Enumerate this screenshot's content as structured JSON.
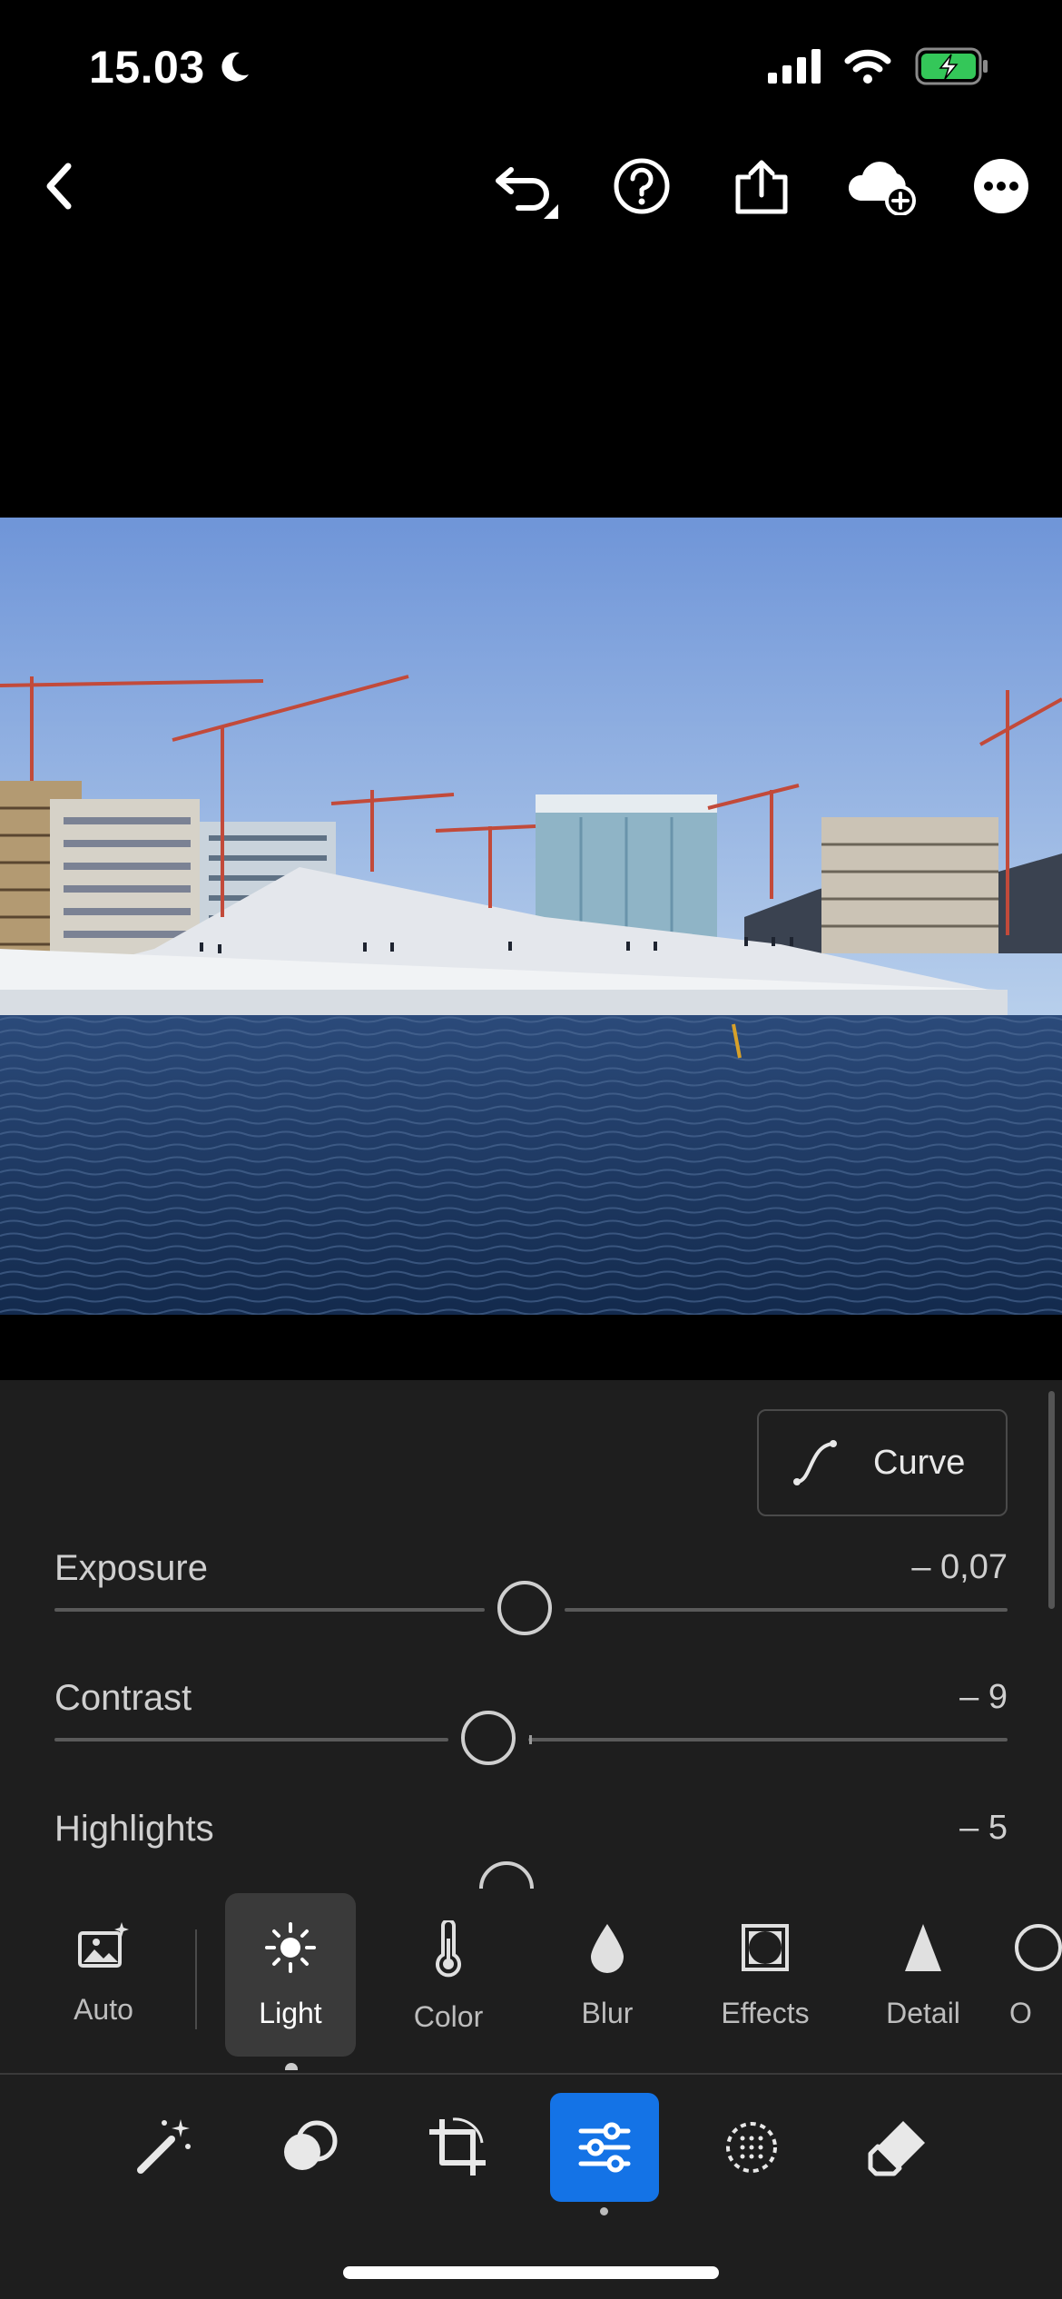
{
  "status": {
    "time": "15.03",
    "moon_icon": "moon-icon",
    "signal_icon": "cellular-signal-icon",
    "wifi_icon": "wifi-icon",
    "battery_icon": "battery-charging-icon",
    "battery_color": "#34c759"
  },
  "toolbar": {
    "back": "back-chevron-icon",
    "undo": "undo-icon",
    "help": "help-icon",
    "share": "share-icon",
    "cloud": "cloud-add-icon",
    "more": "more-icon"
  },
  "photo": {
    "description_icon": "photo-image"
  },
  "panel": {
    "curve_label": "Curve",
    "sliders": [
      {
        "label": "Exposure",
        "value": "– 0,07",
        "position": 0.493
      },
      {
        "label": "Contrast",
        "value": "– 9",
        "position": 0.455
      },
      {
        "label": "Highlights",
        "value": "– 5",
        "position": 0.475
      }
    ]
  },
  "categories": [
    {
      "label": "Auto",
      "icon": "auto-image-icon",
      "active": false
    },
    {
      "label": "Light",
      "icon": "sun-icon",
      "active": true
    },
    {
      "label": "Color",
      "icon": "thermometer-icon",
      "active": false
    },
    {
      "label": "Blur",
      "icon": "drop-icon",
      "active": false
    },
    {
      "label": "Effects",
      "icon": "effects-icon",
      "active": false
    },
    {
      "label": "Detail",
      "icon": "triangle-icon",
      "active": false
    },
    {
      "label": "O",
      "icon": "optics-icon",
      "active": false
    }
  ],
  "tools": [
    {
      "icon": "magic-wand-icon",
      "active": false
    },
    {
      "icon": "presets-icon",
      "active": false
    },
    {
      "icon": "crop-icon",
      "active": false
    },
    {
      "icon": "edit-sliders-icon",
      "active": true
    },
    {
      "icon": "masking-icon",
      "active": false
    },
    {
      "icon": "eraser-icon",
      "active": false
    }
  ],
  "colors": {
    "accent": "#1473e6",
    "panel_bg": "#1e1e1e"
  }
}
